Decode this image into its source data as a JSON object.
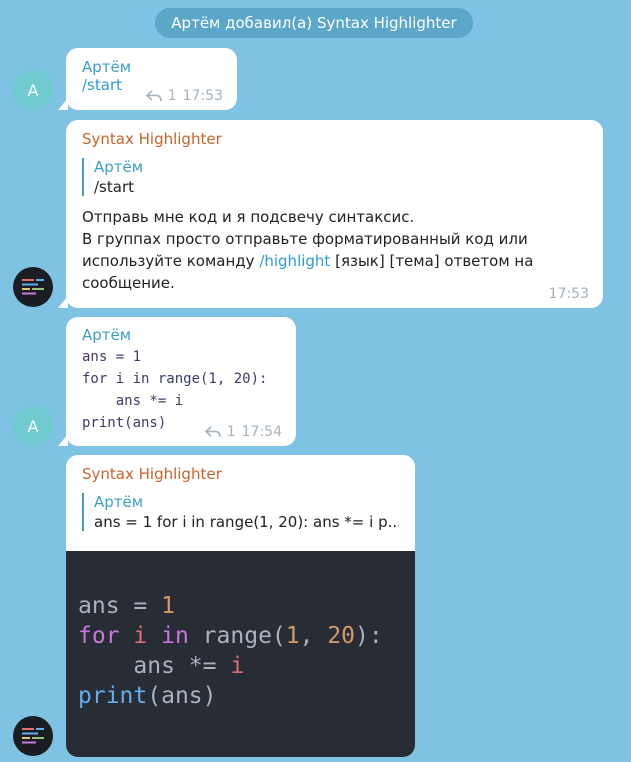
{
  "service_message": "Артём добавил(а) Syntax Highlighter",
  "avatars": {
    "user_letter": "A"
  },
  "messages": {
    "m1": {
      "sender": "Артём",
      "command": "/start",
      "reply_count": "1",
      "time": "17:53"
    },
    "m2": {
      "sender": "Syntax Highlighter",
      "quote_sender": "Артём",
      "quote_text": "/start",
      "line1": "Отправь мне код и я подсвечу синтаксис.",
      "line2_a": "В группах просто отправьте форматированный код или используйте команду ",
      "link": "/highlight",
      "line2_b": " [язык] [тема] ответом на сообщение.",
      "time": "17:53"
    },
    "m3": {
      "sender": "Артём",
      "code": "ans = 1\nfor i in range(1, 20):\n    ans *= i\nprint(ans)",
      "reply_count": "1",
      "time": "17:54"
    },
    "m4": {
      "sender": "Syntax Highlighter",
      "quote_sender": "Артём",
      "quote_text": "ans = 1 for i in range(1, 20):     ans *= i p...",
      "code_tokens": {
        "l1_a": "ans",
        "l1_b": " = ",
        "l1_c": "1",
        "l2_a": "for",
        "l2_b": " ",
        "l2_c": "i",
        "l2_d": " ",
        "l2_e": "in",
        "l2_f": " range(",
        "l2_g": "1",
        "l2_h": ", ",
        "l2_i": "20",
        "l2_j": "):",
        "l3_a": "    ans *= ",
        "l3_b": "i",
        "l4_a": "print",
        "l4_b": "(ans)"
      }
    }
  },
  "colors": {
    "background": "#7ec3e3",
    "user_name": "#3c9fc7",
    "bot_name": "#c7642a",
    "link": "#2d9bd6"
  }
}
